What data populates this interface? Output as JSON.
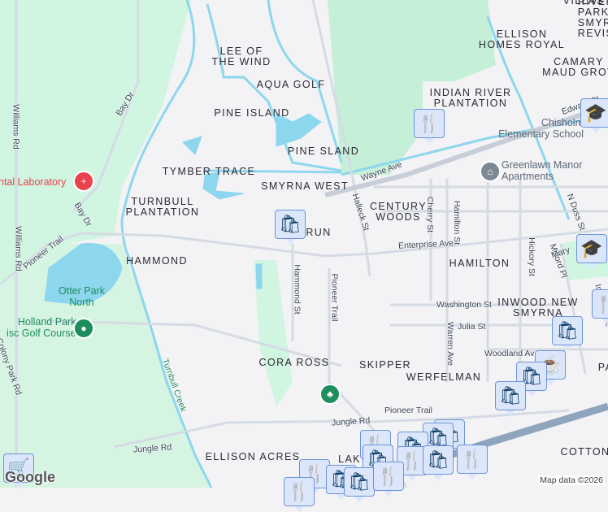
{
  "neighborhoods": [
    "LEE OF",
    "THE WIND",
    "AQUA GOLF",
    "PINE ISLAND",
    "PINE SLAND",
    "TYMBER TRACE",
    "SMYRNA WEST",
    "TURNBULL",
    "PLANTATION",
    "RUN",
    "HAMMOND",
    "INDIAN RIVER",
    "PLANTATION",
    "ELLISON",
    "HOMES ROYAL",
    "CAMARY",
    "MAUD GROV",
    "VILLAS",
    "RIVER",
    "PARK I",
    "SMYR",
    "REVIS",
    "CENTURY",
    "WOODS",
    "HAMILTON",
    "INWOOD NEW",
    "SMYRNA",
    "CORA ROSS",
    "SKIPPER",
    "WERFELMAN",
    "ELLISON ACRES",
    "LAK",
    "COTTON",
    "PA"
  ],
  "roads": [
    "Williams Rd",
    "Williams Rd",
    "Bay Dr",
    "Bay Dr",
    "Pioneer Trail",
    "Wayne Ave",
    "Halleck St",
    "Cherry St",
    "Hamilton St",
    "Enterprise Ave",
    "Hammond St",
    "Pioneer Trail",
    "Washington St",
    "Julia St",
    "Warren Ave",
    "Woodland Ave",
    "Hickory St",
    "Milford Pl",
    "N Duss St",
    "Mary",
    "Edward St",
    "Jungle Rd",
    "Jungle Rd",
    "Pioneer Trail",
    "Colony Park Rd",
    "Turnbull Creek",
    "Inwood Ave",
    "Cherry St"
  ],
  "places": {
    "dental": "ntal Laboratory",
    "otter": "Otter Park\nNorth",
    "otter1": "Otter Park",
    "otter2": "North",
    "holland1": "Holland Park",
    "holland2": "isc Golf Course",
    "greenlawn1": "Greenlawn Manor",
    "greenlawn2": "Apartments",
    "chisholm1": "Chisholm",
    "chisholm2": "Elementary School"
  },
  "pins": {
    "shopping": "shopping-bag",
    "restaurant": "restaurant",
    "school": "school",
    "cafe": "cafe",
    "grocery": "grocery"
  },
  "colors": {
    "park": "#cdf5de",
    "water": "#8dd7ee",
    "road": "#d5dbe4",
    "highway": "#8fa5bd",
    "poi_red": "#e8424f",
    "poi_green": "#1e8e5e",
    "pin_bg": "#dbe6fb",
    "pin_icon": "#0d3d66"
  },
  "attribution": "Map data ©2026",
  "logo": "Google"
}
